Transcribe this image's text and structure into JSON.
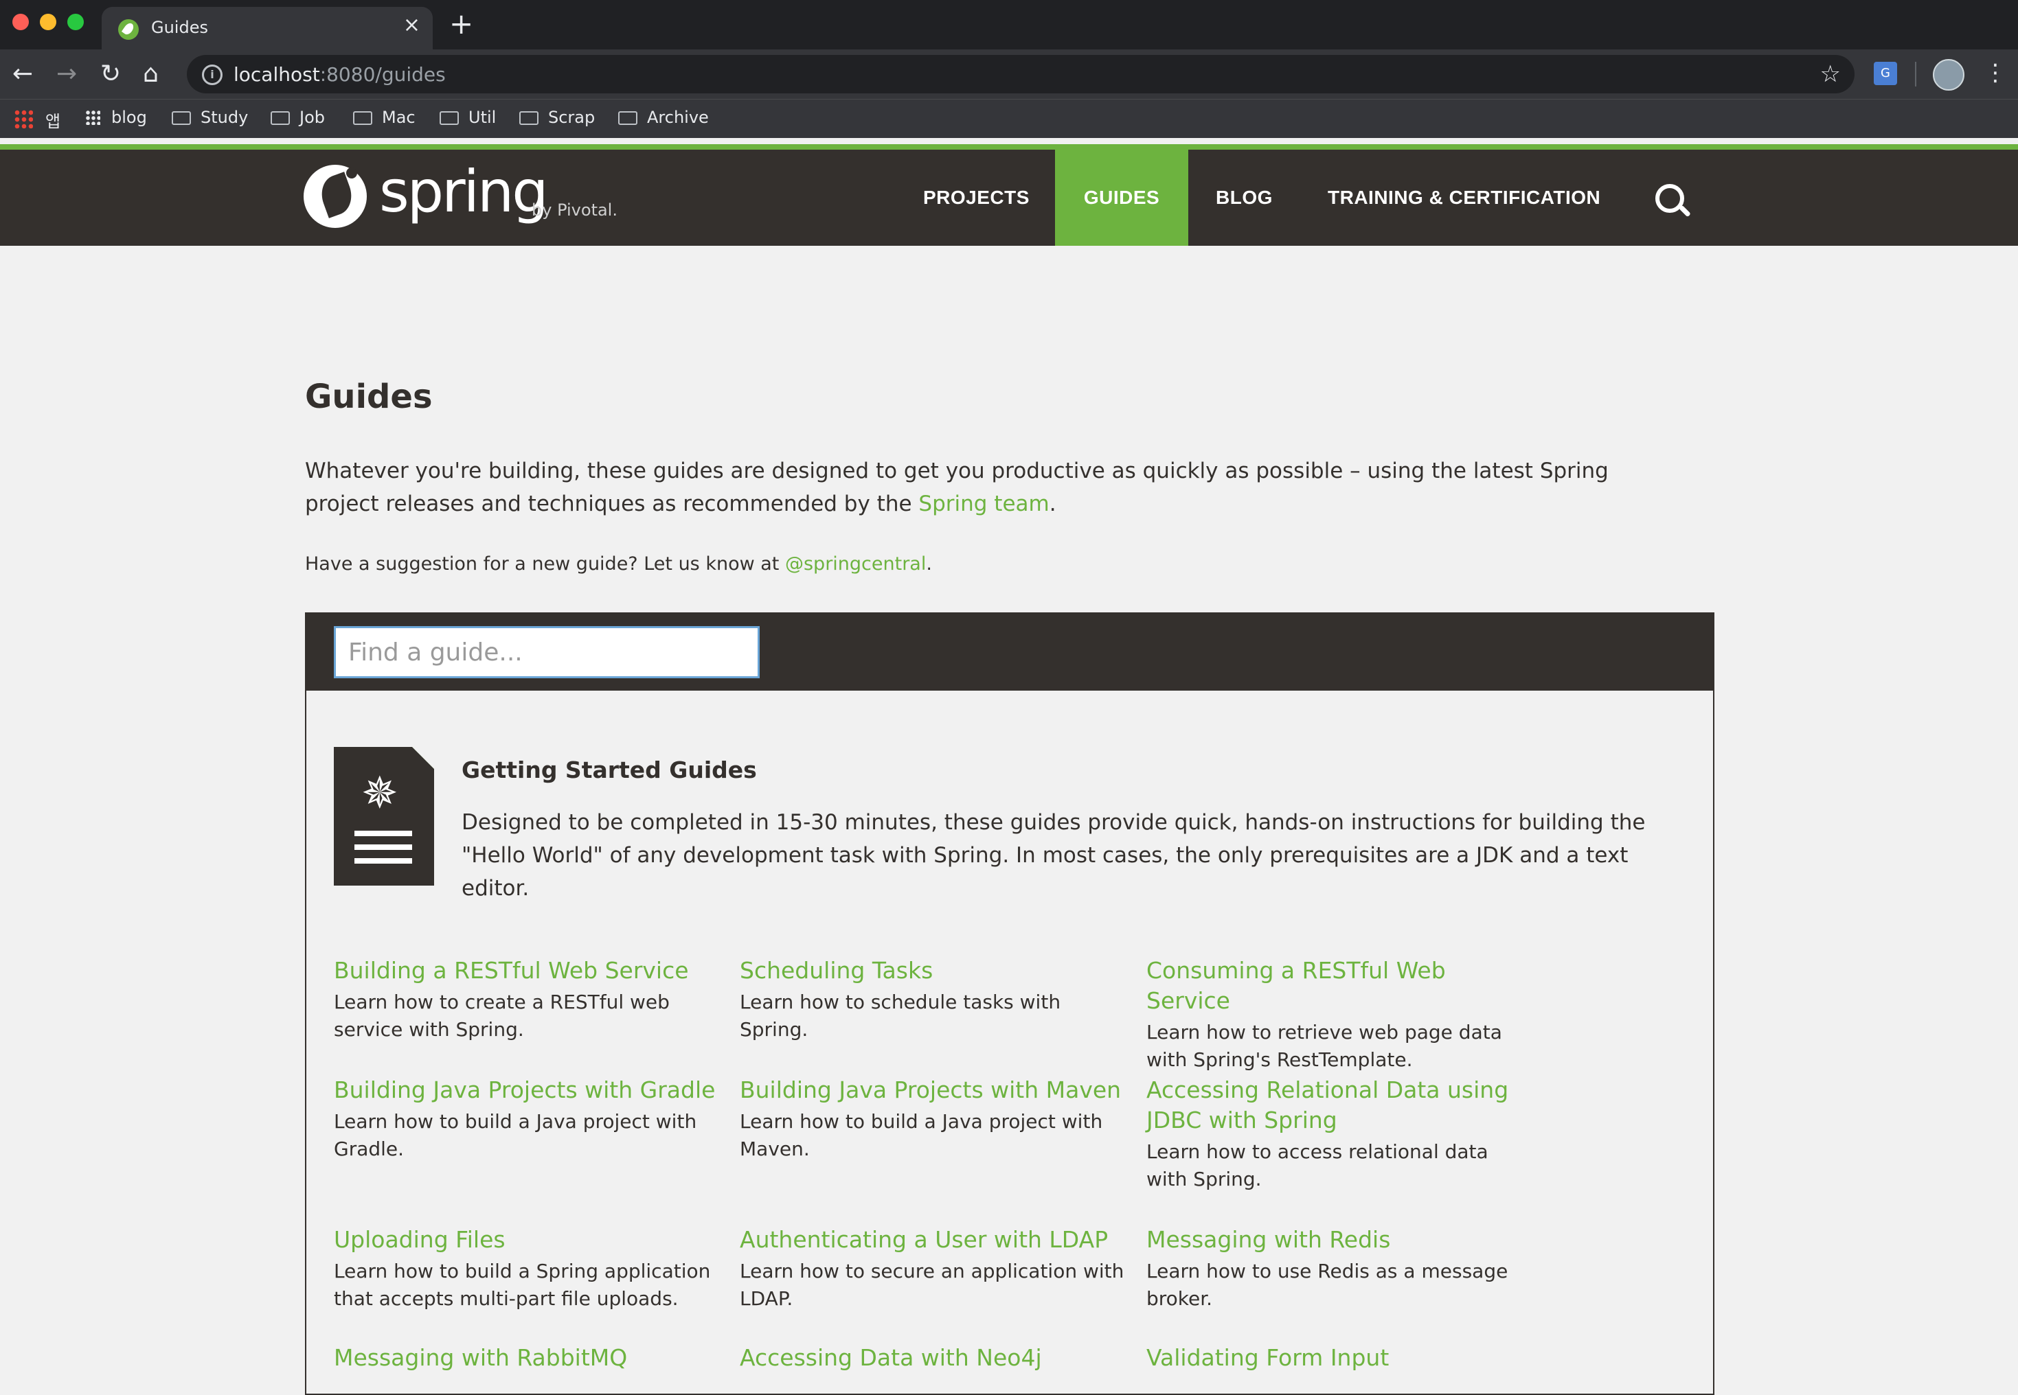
{
  "browser": {
    "tab_title": "Guides",
    "url_host": "localhost",
    "url_rest": ":8080/guides",
    "bookmarks": [
      "앱",
      "blog",
      "Study",
      "Job",
      "Mac",
      "Util",
      "Scrap",
      "Archive"
    ]
  },
  "site": {
    "logo_text": "spring",
    "logo_by": "by Pivotal.",
    "nav": [
      "PROJECTS",
      "GUIDES",
      "BLOG",
      "TRAINING & CERTIFICATION"
    ],
    "active_nav": "GUIDES",
    "accent_color": "#6db33f",
    "header_color": "#34302d"
  },
  "page": {
    "title": "Guides",
    "intro_before": "Whatever you're building, these guides are designed to get you productive as quickly as possible – using the latest Spring project releases and techniques as recommended by the ",
    "intro_link": "Spring team",
    "intro_after": ".",
    "suggest_before": "Have a suggestion for a new guide? Let us know at ",
    "suggest_link": "@springcentral",
    "suggest_after": "."
  },
  "guides": {
    "search_placeholder": "Find a guide...",
    "section_title": "Getting Started Guides",
    "section_desc": "Designed to be completed in 15-30 minutes, these guides provide quick, hands-on instructions for building the \"Hello World\" of any development task with Spring. In most cases, the only prerequisites are a JDK and a text editor.",
    "items": [
      {
        "title": "Building a RESTful Web Service",
        "desc": "Learn how to create a RESTful web service with Spring."
      },
      {
        "title": "Scheduling Tasks",
        "desc": "Learn how to schedule tasks with Spring."
      },
      {
        "title": "Consuming a RESTful Web Service",
        "desc": "Learn how to retrieve web page data with Spring's RestTemplate."
      },
      {
        "title": "Building Java Projects with Gradle",
        "desc": "Learn how to build a Java project with Gradle."
      },
      {
        "title": "Building Java Projects with Maven",
        "desc": "Learn how to build a Java project with Maven."
      },
      {
        "title": "Accessing Relational Data using JDBC with Spring",
        "desc": "Learn how to access relational data with Spring."
      },
      {
        "title": "Uploading Files",
        "desc": "Learn how to build a Spring application that accepts multi-part file uploads."
      },
      {
        "title": "Authenticating a User with LDAP",
        "desc": "Learn how to secure an application with LDAP."
      },
      {
        "title": "Messaging with Redis",
        "desc": "Learn how to use Redis as a message broker."
      },
      {
        "title": "Messaging with RabbitMQ",
        "desc": ""
      },
      {
        "title": "Accessing Data with Neo4j",
        "desc": ""
      },
      {
        "title": "Validating Form Input",
        "desc": ""
      }
    ]
  }
}
